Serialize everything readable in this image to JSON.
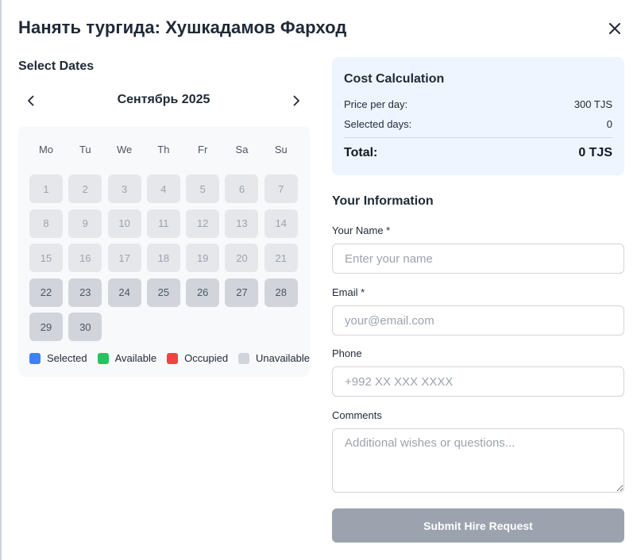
{
  "modal": {
    "title": "Нанять тургида: Хушкадамов Фарход"
  },
  "calendar": {
    "section_label": "Select Dates",
    "month_label": "Сентябрь 2025",
    "weekdays": [
      "Mo",
      "Tu",
      "We",
      "Th",
      "Fr",
      "Sa",
      "Su"
    ],
    "days": [
      {
        "label": "1",
        "state": "past"
      },
      {
        "label": "2",
        "state": "past"
      },
      {
        "label": "3",
        "state": "past"
      },
      {
        "label": "4",
        "state": "past"
      },
      {
        "label": "5",
        "state": "past"
      },
      {
        "label": "6",
        "state": "past"
      },
      {
        "label": "7",
        "state": "past"
      },
      {
        "label": "8",
        "state": "past"
      },
      {
        "label": "9",
        "state": "past"
      },
      {
        "label": "10",
        "state": "past"
      },
      {
        "label": "11",
        "state": "past"
      },
      {
        "label": "12",
        "state": "past"
      },
      {
        "label": "13",
        "state": "past"
      },
      {
        "label": "14",
        "state": "past"
      },
      {
        "label": "15",
        "state": "past"
      },
      {
        "label": "16",
        "state": "past"
      },
      {
        "label": "17",
        "state": "past"
      },
      {
        "label": "18",
        "state": "past"
      },
      {
        "label": "19",
        "state": "past"
      },
      {
        "label": "20",
        "state": "past"
      },
      {
        "label": "21",
        "state": "past"
      },
      {
        "label": "22",
        "state": "future"
      },
      {
        "label": "23",
        "state": "future"
      },
      {
        "label": "24",
        "state": "future"
      },
      {
        "label": "25",
        "state": "future"
      },
      {
        "label": "26",
        "state": "future"
      },
      {
        "label": "27",
        "state": "future"
      },
      {
        "label": "28",
        "state": "future"
      },
      {
        "label": "29",
        "state": "future"
      },
      {
        "label": "30",
        "state": "future"
      }
    ],
    "legend": [
      {
        "label": "Selected",
        "color": "#3b82f6"
      },
      {
        "label": "Available",
        "color": "#22c55e"
      },
      {
        "label": "Occupied",
        "color": "#ef4444"
      },
      {
        "label": "Unavailable",
        "color": "#d1d5db"
      }
    ]
  },
  "cost": {
    "title": "Cost Calculation",
    "price_label": "Price per day:",
    "price_value": "300 TJS",
    "days_label": "Selected days:",
    "days_value": "0",
    "total_label": "Total:",
    "total_value": "0 TJS"
  },
  "form": {
    "section_title": "Your Information",
    "name_label": "Your Name *",
    "name_placeholder": "Enter your name",
    "email_label": "Email *",
    "email_placeholder": "your@email.com",
    "phone_label": "Phone",
    "phone_placeholder": "+992 XX XXX XXXX",
    "comments_label": "Comments",
    "comments_placeholder": "Additional wishes or questions...",
    "submit_label": "Submit Hire Request"
  },
  "colors": {
    "accent_panel": "#eef5ff",
    "submit_disabled": "#9ca3af"
  }
}
